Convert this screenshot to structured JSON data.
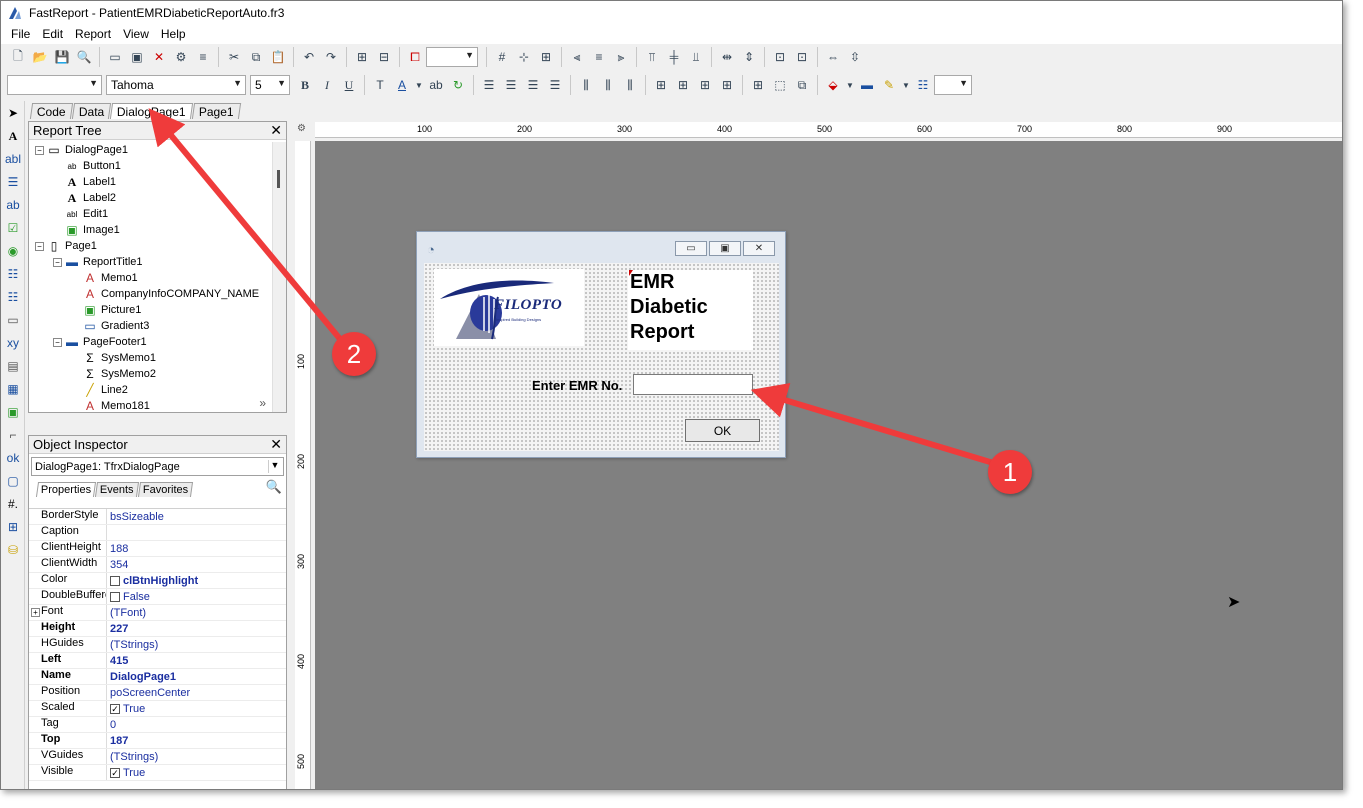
{
  "window": {
    "title": "FastReport - PatientEMRDiabeticReportAuto.fr3"
  },
  "menu": [
    "File",
    "Edit",
    "Report",
    "View",
    "Help"
  ],
  "format_toolbar": {
    "font_name": "Tahoma",
    "font_size": "5"
  },
  "page_tabs": [
    {
      "label": "Code",
      "active": false
    },
    {
      "label": "Data",
      "active": false
    },
    {
      "label": "DialogPage1",
      "active": true
    },
    {
      "label": "Page1",
      "active": false
    }
  ],
  "report_tree": {
    "title": "Report Tree",
    "items": [
      {
        "label": "DialogPage1",
        "level": 0,
        "icon": "dialog-page-icon",
        "expand": "−"
      },
      {
        "label": "Button1",
        "level": 1,
        "icon": "button-icon"
      },
      {
        "label": "Label1",
        "level": 1,
        "icon": "label-icon"
      },
      {
        "label": "Label2",
        "level": 1,
        "icon": "label-icon"
      },
      {
        "label": "Edit1",
        "level": 1,
        "icon": "edit-icon"
      },
      {
        "label": "Image1",
        "level": 1,
        "icon": "image-icon"
      },
      {
        "label": "Page1",
        "level": 0,
        "icon": "page-icon",
        "expand": "−"
      },
      {
        "label": "ReportTitle1",
        "level": 1,
        "icon": "band-icon",
        "expand": "−"
      },
      {
        "label": "Memo1",
        "level": 2,
        "icon": "memo-icon"
      },
      {
        "label": "CompanyInfoCOMPANY_NAME",
        "level": 2,
        "icon": "memo-icon"
      },
      {
        "label": "Picture1",
        "level": 2,
        "icon": "picture-icon"
      },
      {
        "label": "Gradient3",
        "level": 2,
        "icon": "gradient-icon"
      },
      {
        "label": "PageFooter1",
        "level": 1,
        "icon": "band-icon",
        "expand": "−"
      },
      {
        "label": "SysMemo1",
        "level": 2,
        "icon": "sysmemo-icon"
      },
      {
        "label": "SysMemo2",
        "level": 2,
        "icon": "sysmemo-icon"
      },
      {
        "label": "Line2",
        "level": 2,
        "icon": "line-icon"
      },
      {
        "label": "Memo181",
        "level": 2,
        "icon": "memo-icon"
      }
    ]
  },
  "object_inspector": {
    "title": "Object Inspector",
    "selected": "DialogPage1: TfrxDialogPage",
    "tabs": [
      "Properties",
      "Events",
      "Favorites"
    ],
    "properties": [
      {
        "name": "BorderStyle",
        "value": "bsSizeable",
        "bold": false
      },
      {
        "name": "Caption",
        "value": "",
        "bold": false
      },
      {
        "name": "ClientHeight",
        "value": "188",
        "bold": false
      },
      {
        "name": "ClientWidth",
        "value": "354",
        "bold": false
      },
      {
        "name": "Color",
        "value": "clBtnHighlight",
        "bold": false,
        "checkbox": "",
        "value_bold": true
      },
      {
        "name": "DoubleBuffered",
        "value": "False",
        "bold": false,
        "checkbox": ""
      },
      {
        "name": "Font",
        "value": "(TFont)",
        "bold": false,
        "expand": "+"
      },
      {
        "name": "Height",
        "value": "227",
        "bold": true,
        "value_bold": true
      },
      {
        "name": "HGuides",
        "value": "(TStrings)",
        "bold": false
      },
      {
        "name": "Left",
        "value": "415",
        "bold": true,
        "value_bold": true
      },
      {
        "name": "Name",
        "value": "DialogPage1",
        "bold": true,
        "value_bold": true
      },
      {
        "name": "Position",
        "value": "poScreenCenter",
        "bold": false
      },
      {
        "name": "Scaled",
        "value": "True",
        "bold": false,
        "checkbox": "✓"
      },
      {
        "name": "Tag",
        "value": "0",
        "bold": false
      },
      {
        "name": "Top",
        "value": "187",
        "bold": true,
        "value_bold": true
      },
      {
        "name": "VGuides",
        "value": "(TStrings)",
        "bold": false
      },
      {
        "name": "Visible",
        "value": "True",
        "bold": false,
        "checkbox": "✓"
      }
    ]
  },
  "ruler": {
    "h_ticks": [
      "100",
      "200",
      "300",
      "400",
      "500",
      "600",
      "700",
      "800",
      "900"
    ],
    "v_ticks": [
      "100",
      "200",
      "300",
      "400",
      "500"
    ]
  },
  "dialog": {
    "heading": [
      "EMR",
      "Diabetic",
      "Report"
    ],
    "logo_text": "FILOPTO",
    "logo_subtext": "Inspired Building Designs",
    "prompt_label": "Enter EMR No.",
    "ok_label": "OK"
  },
  "annotations": [
    {
      "number": "1",
      "color": "#ef3b3b"
    },
    {
      "number": "2",
      "color": "#ef3b3b"
    }
  ]
}
